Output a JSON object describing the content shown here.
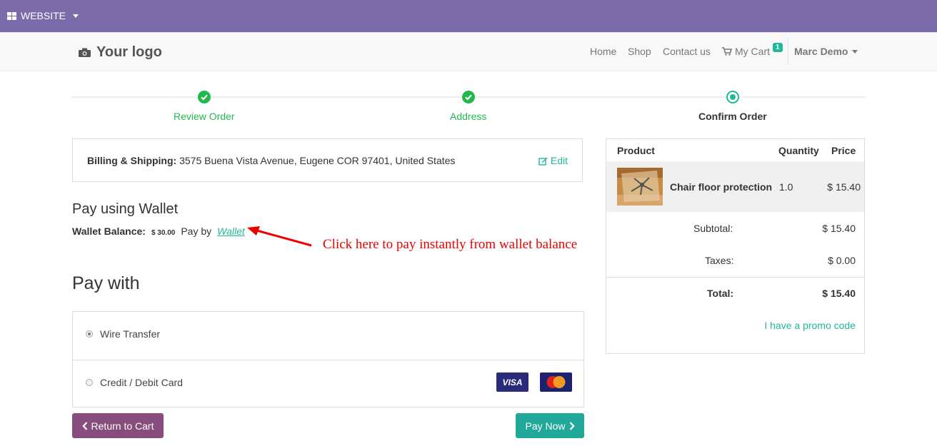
{
  "topbar": {
    "website_label": "WEBSITE"
  },
  "navbar": {
    "logo_text": "Your logo",
    "links": {
      "home": "Home",
      "shop": "Shop",
      "contact": "Contact us",
      "cart": "My Cart"
    },
    "cart_count": "1",
    "user": "Marc Demo"
  },
  "steps": [
    {
      "label": "Review Order",
      "state": "done"
    },
    {
      "label": "Address",
      "state": "done"
    },
    {
      "label": "Confirm Order",
      "state": "current"
    }
  ],
  "billing": {
    "label": "Billing & Shipping:",
    "address": "3575 Buena Vista Avenue, Eugene COR 97401, United States",
    "edit": "Edit"
  },
  "wallet": {
    "title": "Pay using Wallet",
    "balance_label": "Wallet Balance:",
    "balance": "$ 30.00",
    "pay_by": "Pay by",
    "link": "Wallet"
  },
  "annotation": "Click here to pay instantly from wallet balance",
  "pay_with": {
    "title": "Pay with",
    "options": [
      {
        "label": "Wire Transfer",
        "checked": true
      },
      {
        "label": "Credit / Debit Card",
        "checked": false
      }
    ],
    "visa_label": "VISA"
  },
  "buttons": {
    "return": "Return to Cart",
    "pay": "Pay Now"
  },
  "summary": {
    "headers": {
      "product": "Product",
      "quantity": "Quantity",
      "price": "Price"
    },
    "item": {
      "name": "Chair floor protection",
      "qty": "1.0",
      "price": "$ 15.40"
    },
    "subtotal_label": "Subtotal:",
    "subtotal": "$ 15.40",
    "taxes_label": "Taxes:",
    "taxes": "$ 0.00",
    "total_label": "Total:",
    "total": "$ 15.40",
    "promo": "I have a promo code"
  },
  "colors": {
    "topbar": "#7c6bab",
    "accent": "#21b799",
    "success": "#21b94c",
    "return_btn": "#874d7d",
    "annotation": "#ee0000"
  }
}
